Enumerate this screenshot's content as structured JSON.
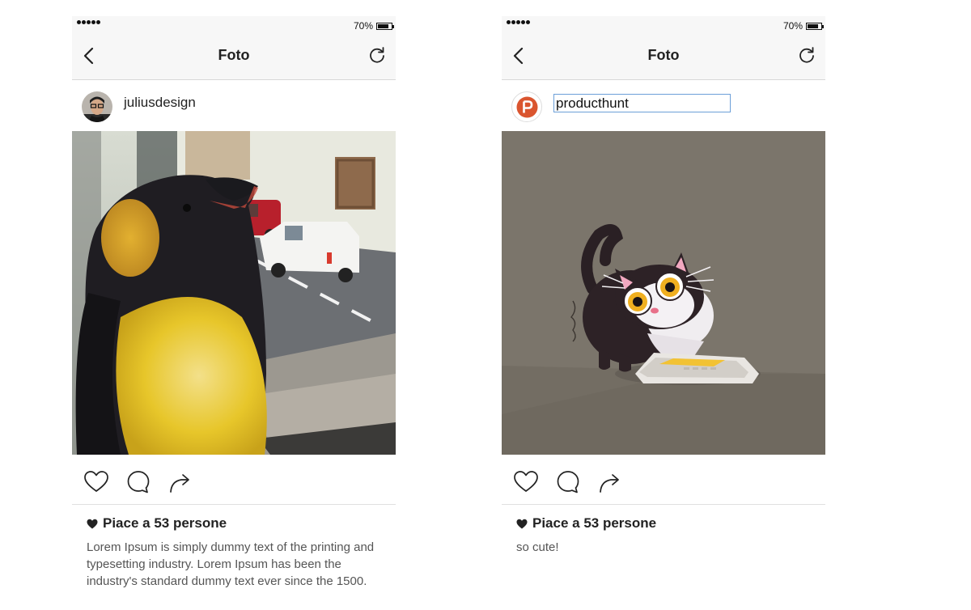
{
  "phones": [
    {
      "status": {
        "battery": "70%",
        "signal_dots": 5
      },
      "nav": {
        "title": "Foto"
      },
      "user": {
        "name": "juliusdesign"
      },
      "photo": {
        "subject": "penguin figurine by a window"
      },
      "likes": {
        "text": "Piace a 53 persone"
      },
      "caption": "Lorem Ipsum is simply dummy text of the printing and typesetting industry. Lorem Ipsum has been the industry's standard dummy text ever since the 1500."
    },
    {
      "status": {
        "battery": "70%",
        "signal_dots": 5
      },
      "nav": {
        "title": "Foto"
      },
      "user": {
        "name": "producthunt"
      },
      "photo": {
        "subject": "cartoon cat with smartphone"
      },
      "likes": {
        "text": "Piace a 53 persone"
      },
      "caption": "so cute!"
    }
  ],
  "icons": [
    "back-icon",
    "refresh-icon",
    "heart-icon",
    "comment-icon",
    "share-icon",
    "producthunt-logo-icon"
  ],
  "colors": {
    "bar_bg": "#f7f7f7",
    "producthunt": "#da552f",
    "input_border": "#6c9fd8"
  }
}
